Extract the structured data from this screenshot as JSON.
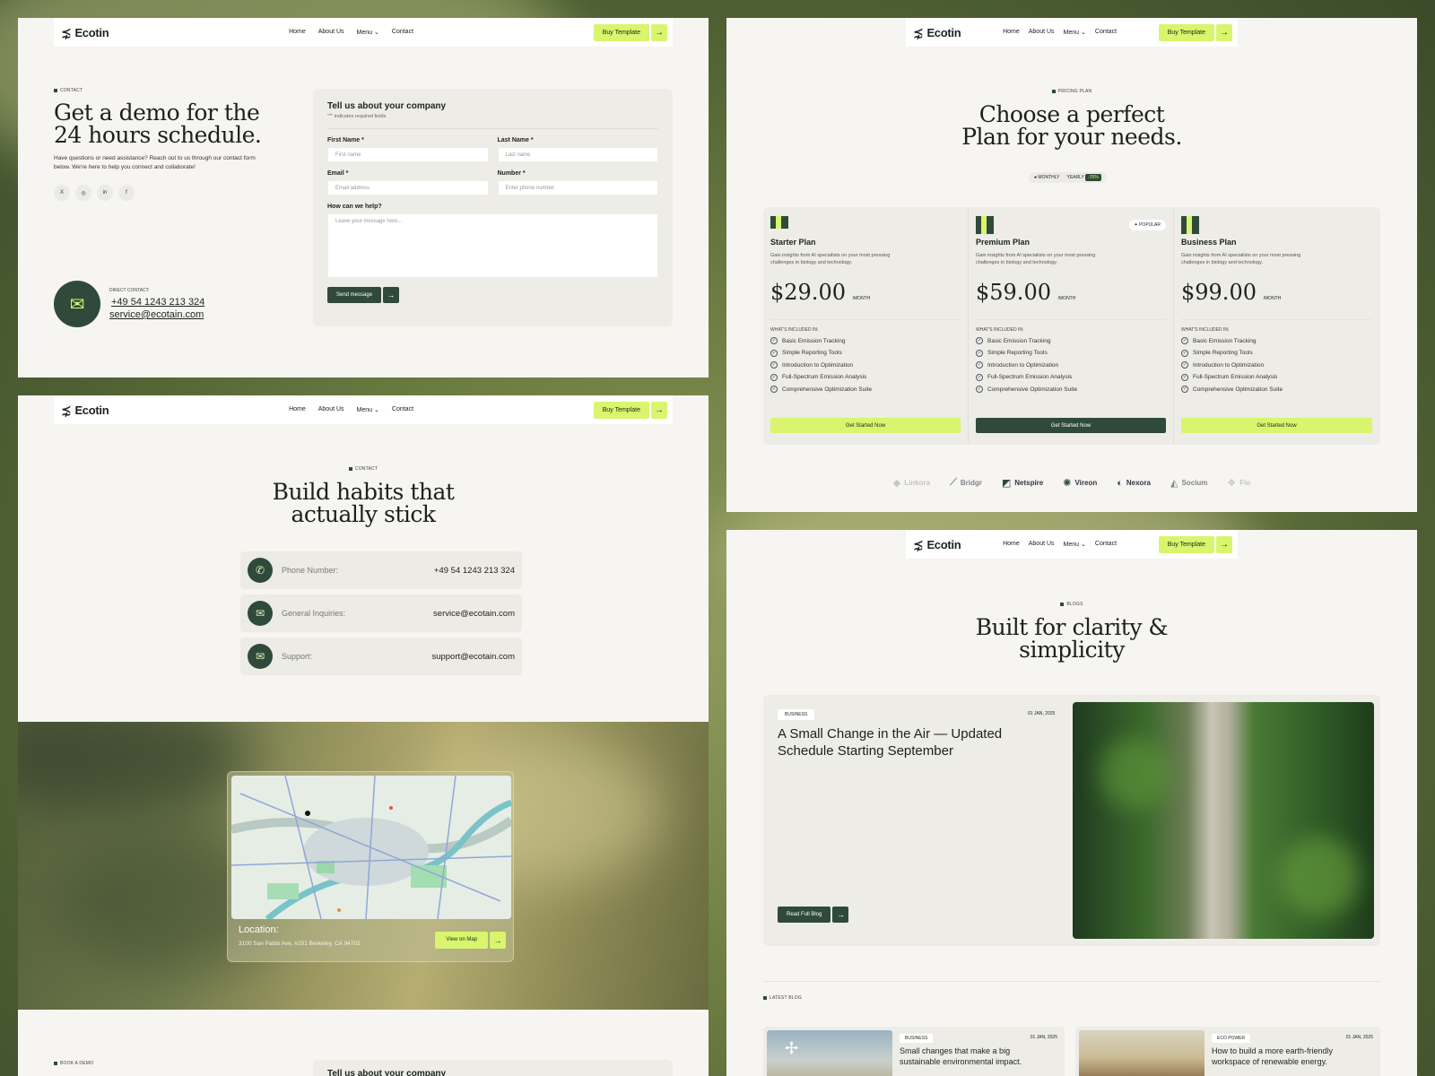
{
  "nav": {
    "logo": "Ecotin",
    "links": [
      "Home",
      "About Us",
      "Menu",
      "Contact"
    ],
    "cta": "Buy Template"
  },
  "demo": {
    "tag": "CONTACT",
    "title": "Get a demo for the 24 hours schedule.",
    "desc": "Have questions or need assistance? Reach out to us through our contact form below. We're here to help you connect and collaborate!",
    "social": [
      "X",
      "◎",
      "in",
      "f"
    ],
    "direct_label": "DIRECT CONTACT:",
    "phone": "+49 54 1243 213 324",
    "email": "service@ecotain.com",
    "form": {
      "title": "Tell us about your company",
      "sub": "\"*\" indicates required fields",
      "first_label": "First Name *",
      "first_ph": "First name",
      "last_label": "Last Name *",
      "last_ph": "Last name",
      "email_label": "Email *",
      "email_ph": "Email address",
      "number_label": "Number *",
      "number_ph": "Enter phone number",
      "help_label": "How can we help?",
      "msg_ph": "Leave your message here...",
      "send": "Send message"
    }
  },
  "contact": {
    "tag": "CONTACT",
    "title_l1": "Build habits that",
    "title_l2": "actually stick",
    "rows": [
      {
        "label": "Phone Number:",
        "value": "+49 54 1243 213 324"
      },
      {
        "label": "General Inquiries:",
        "value": "service@ecotain.com"
      },
      {
        "label": "Support:",
        "value": "support@ecotain.com"
      }
    ],
    "location_label": "Location:",
    "address": "3100 San Pablo Ave, #201 Berkeley, CA 94702",
    "map_btn": "View on Map",
    "bottom_tag": "BOOK A DEMO",
    "bottom_form_title": "Tell us about your company"
  },
  "pricing": {
    "tag": "PRICING PLAN",
    "title_l1": "Choose a perfect",
    "title_l2": "Plan for your needs.",
    "toggle_monthly": "MONTHLY",
    "toggle_yearly": "YEARLY",
    "toggle_badge": "-25%",
    "popular": "POPULAR",
    "included": "WHAT'S INCLUDED IN:",
    "desc": "Gain insights from AI specialists on your most pressing challenges in biology and technology.",
    "plans": [
      {
        "name": "Starter Plan",
        "price": "$29.00",
        "per": "/MONTH",
        "cta": "Get Started Now"
      },
      {
        "name": "Premium Plan",
        "price": "$59.00",
        "per": "/MONTH",
        "cta": "Get Started Now"
      },
      {
        "name": "Business Plan",
        "price": "$99.00",
        "per": "/MONTH",
        "cta": "Get Started Now"
      }
    ],
    "features": [
      "Basic Emission Tracking",
      "Simple Reporting Tools",
      "Introduction to Optimization",
      "Full-Spectrum Emission Analysis",
      "Comprehensive Optimization Suite"
    ],
    "brands": [
      "Linkora",
      "Bridgr",
      "Netspire",
      "Vireon",
      "Nexora",
      "Socium",
      "Flo"
    ]
  },
  "blog": {
    "tag": "BLOGS",
    "title_l1": "Built for clarity &",
    "title_l2": "simplicity",
    "featured_cat": "BUSINESS",
    "featured_date": "01 JAN, 2025",
    "featured_title": "A Small Change in the Air — Updated Schedule Starting September",
    "read_btn": "Read Full Blog",
    "latest_tag": "LATEST BLOG",
    "cards": [
      {
        "cat": "BUSINESS",
        "date": "01 JAN, 2025",
        "title": "Small changes that make a big sustainable environmental impact."
      },
      {
        "cat": "ECO POWER",
        "date": "01 JAN, 2025",
        "title": "How to build a more earth-friendly workspace of renewable energy."
      }
    ]
  },
  "colors": {
    "accent": "#d8f56d",
    "dark": "#2f4a3a",
    "panel": "#f6f5f1"
  }
}
